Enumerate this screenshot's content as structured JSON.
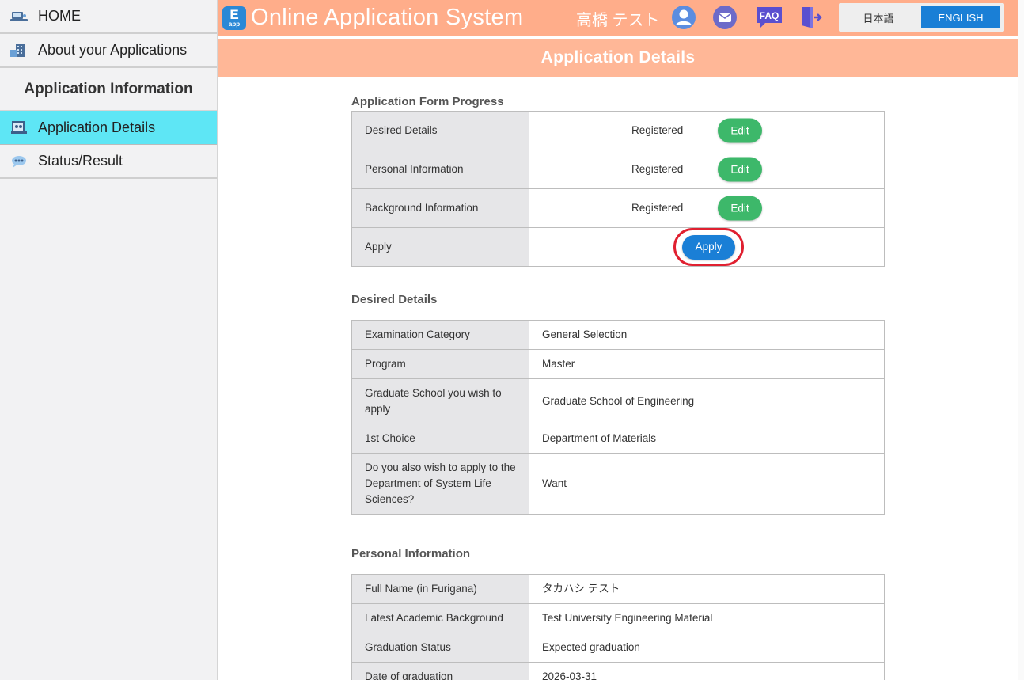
{
  "sidebar": {
    "home": "HOME",
    "about": "About your Applications",
    "section_header": "Application Information",
    "details": "Application Details",
    "status": "Status/Result"
  },
  "header": {
    "logo_letter": "E",
    "logo_sub": "app",
    "title": "Online Application System",
    "username": "高橋 テスト",
    "faq": "FAQ",
    "lang_ja": "日本語",
    "lang_en": "ENGLISH"
  },
  "page_title": "Application Details",
  "progress": {
    "title": "Application Form  Progress",
    "rows": [
      {
        "label": "Desired Details",
        "status": "Registered",
        "action": "Edit"
      },
      {
        "label": "Personal Information",
        "status": "Registered",
        "action": "Edit"
      },
      {
        "label": "Background Information",
        "status": "Registered",
        "action": "Edit"
      },
      {
        "label": "Apply",
        "action": "Apply"
      }
    ]
  },
  "desired": {
    "title": "Desired Details",
    "rows": [
      {
        "label": "Examination Category",
        "value": "General Selection"
      },
      {
        "label": "Program",
        "value": "Master"
      },
      {
        "label": "Graduate School you wish to apply",
        "value": "Graduate School of Engineering"
      },
      {
        "label": "1st Choice",
        "value": "Department of Materials"
      },
      {
        "label": "Do you also wish to apply to the Department of System Life Sciences?",
        "value": "Want"
      }
    ]
  },
  "personal": {
    "title": "Personal Information",
    "rows": [
      {
        "label": "Full Name (in Furigana)",
        "value": "タカハシ テスト"
      },
      {
        "label": "Latest Academic Background",
        "value": "Test University Engineering Material"
      },
      {
        "label": "Graduation Status",
        "value": "Expected graduation"
      },
      {
        "label": "Date of graduation",
        "value": "2026-03-31"
      }
    ]
  },
  "colors": {
    "header": "#ffad8a",
    "active_sidebar": "#5ee6f5",
    "edit_button": "#3db86a",
    "apply_button": "#1a7fd6",
    "highlight_ring": "#e02030"
  }
}
